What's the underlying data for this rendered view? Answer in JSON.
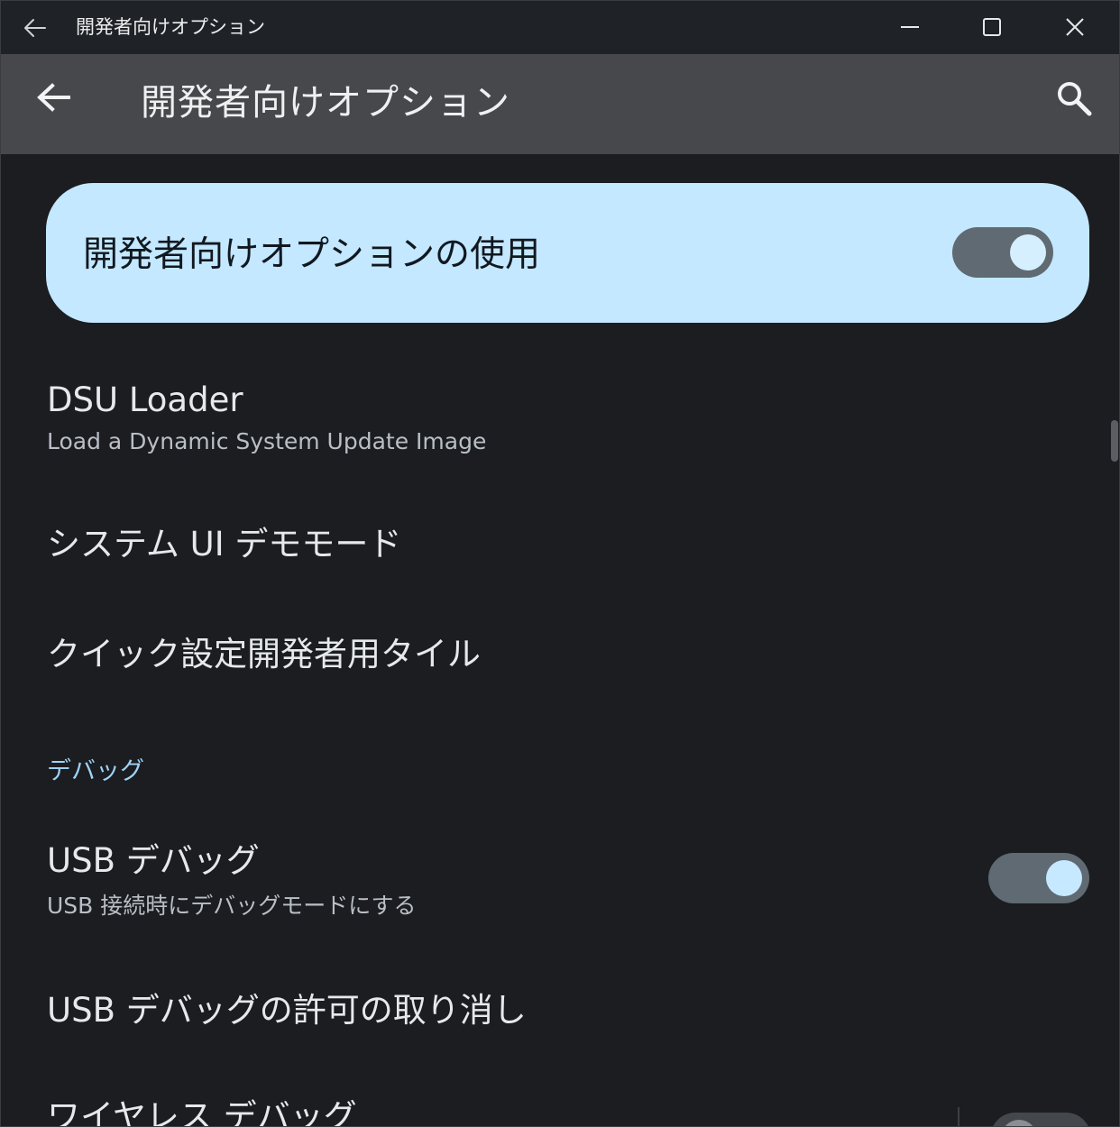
{
  "window": {
    "title": "開発者向けオプション"
  },
  "appbar": {
    "title": "開発者向けオプション",
    "back_icon": "arrow-left-icon",
    "search_icon": "search-icon"
  },
  "master_switch": {
    "label": "開発者向けオプションの使用",
    "state": "on"
  },
  "items": [
    {
      "title": "DSU Loader",
      "subtitle": "Load a Dynamic System Update Image"
    },
    {
      "title": "システム UI デモモード"
    },
    {
      "title": "クイック設定開発者用タイル"
    }
  ],
  "debug_section": {
    "header": "デバッグ",
    "usb_debug": {
      "title": "USB デバッグ",
      "subtitle": "USB 接続時にデバッグモードにする",
      "state": "on"
    },
    "revoke": {
      "title": "USB デバッグの許可の取り消し"
    },
    "wireless": {
      "title": "ワイヤレス デバッグ",
      "state": "off"
    }
  },
  "colors": {
    "accent_card": "#c3e8ff",
    "section_header": "#9fd3f5",
    "background": "#1b1d21",
    "appbar": "#47484b"
  }
}
